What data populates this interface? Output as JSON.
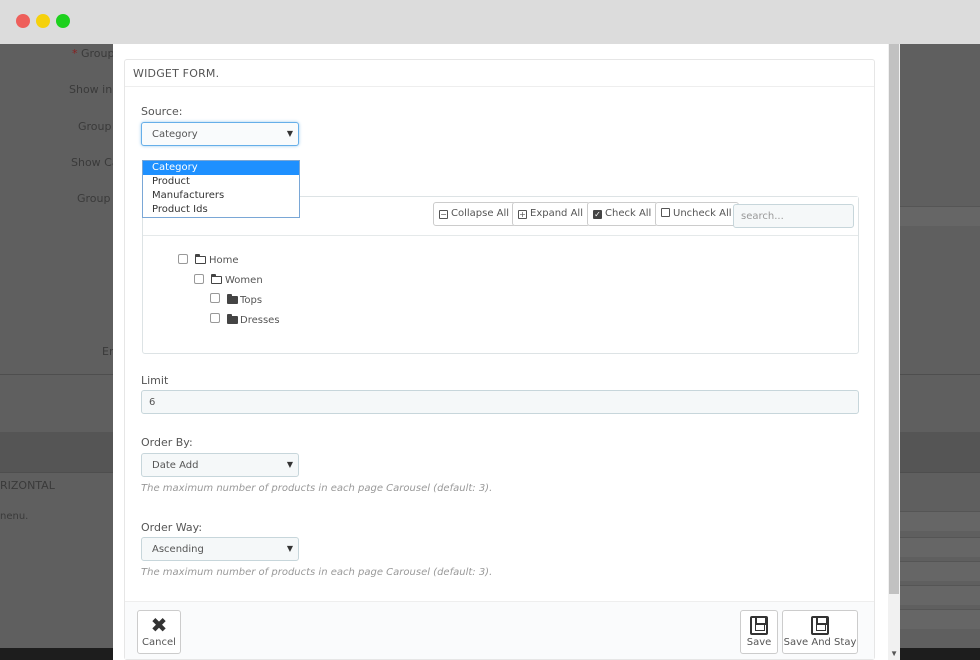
{
  "background": {
    "labels": [
      "Group",
      "Show in",
      "Group",
      "Show Ca",
      "Group C",
      "En"
    ],
    "section_label": "RIZONTAL",
    "section_text": "nenu."
  },
  "modal": {
    "title": "WIDGET FORM.",
    "source": {
      "label": "Source:",
      "value": "Category",
      "options": [
        "Category",
        "Product",
        "Manufacturers",
        "Product Ids"
      ]
    },
    "tree": {
      "collapse_all": "Collapse All",
      "expand_all": "Expand All",
      "check_all": "Check All",
      "uncheck_all": "Uncheck All",
      "search_placeholder": "search...",
      "nodes": [
        {
          "label": "Home"
        },
        {
          "label": "Women"
        },
        {
          "label": "Tops"
        },
        {
          "label": "Dresses"
        }
      ]
    },
    "limit": {
      "label": "Limit",
      "value": "6"
    },
    "order_by": {
      "label": "Order By:",
      "value": "Date Add",
      "help": "The maximum number of products in each page Carousel (default: 3)."
    },
    "order_way": {
      "label": "Order Way:",
      "value": "Ascending",
      "help": "The maximum number of products in each page Carousel (default: 3)."
    },
    "footer": {
      "cancel": "Cancel",
      "save": "Save",
      "save_and_stay": "Save And Stay"
    }
  }
}
